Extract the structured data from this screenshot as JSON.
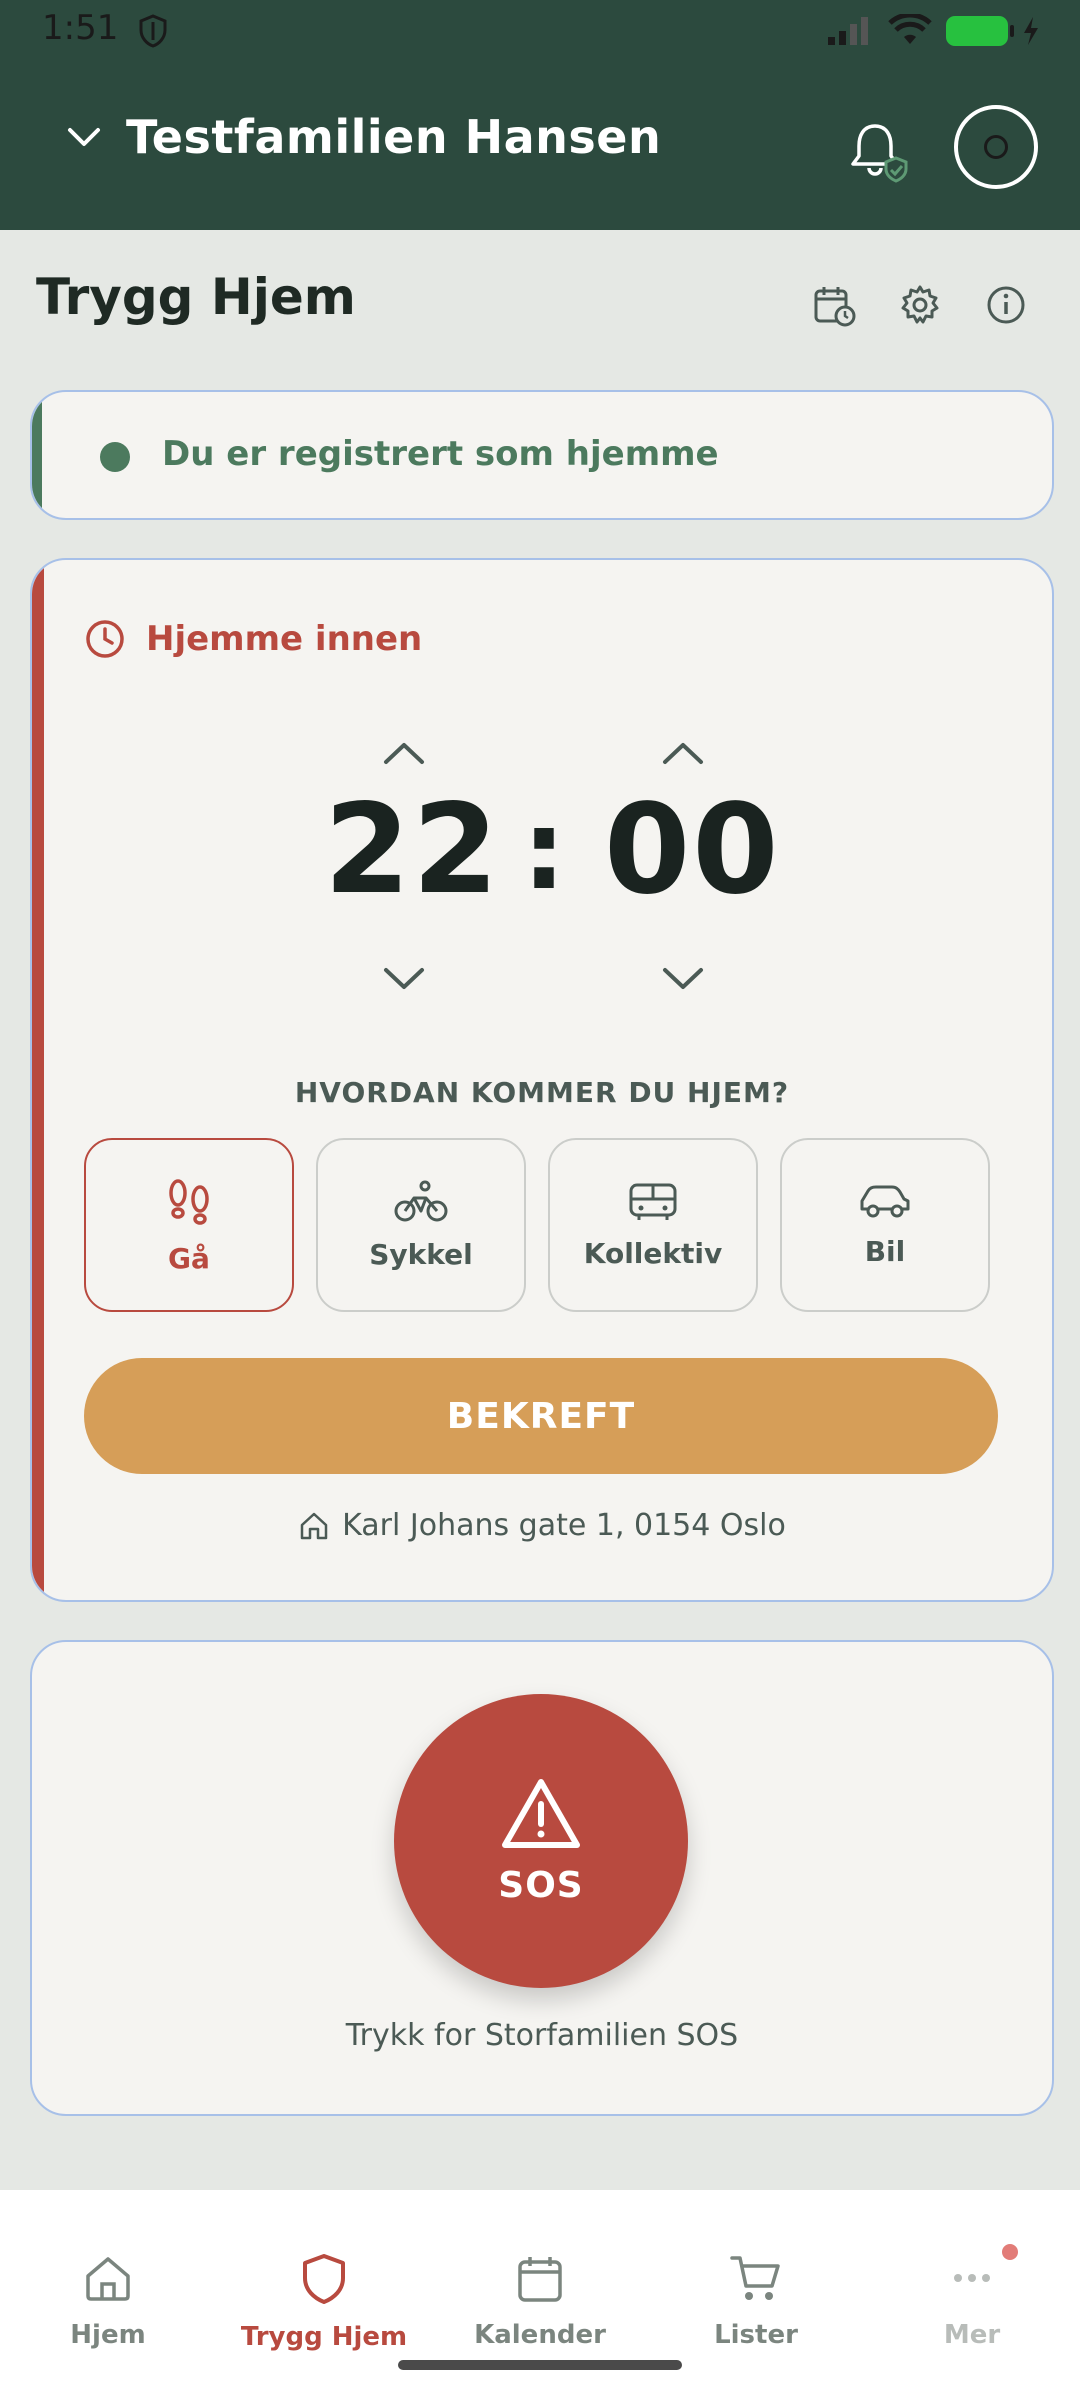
{
  "status_bar": {
    "time": "1:51"
  },
  "header": {
    "family_name": "Testfamilien Hansen",
    "avatar_initial": "O"
  },
  "page": {
    "title": "Trygg Hjem"
  },
  "status_card": {
    "text": "Du er registrert som hjemme",
    "color": "#4C7A5E"
  },
  "home_card": {
    "deadline_label": "Hjemme innen",
    "hours": "22",
    "separator": ":",
    "minutes": "00",
    "transport_question": "HVORDAN KOMMER DU HJEM?",
    "modes": [
      {
        "label": "Gå",
        "icon": "footsteps-icon",
        "selected": true
      },
      {
        "label": "Sykkel",
        "icon": "bicycle-icon",
        "selected": false
      },
      {
        "label": "Kollektiv",
        "icon": "bus-icon",
        "selected": false
      },
      {
        "label": "Bil",
        "icon": "car-icon",
        "selected": false
      }
    ],
    "confirm_label": "BEKREFT",
    "address": "Karl Johans gate 1, 0154 Oslo",
    "accent_color": "#B84A3F"
  },
  "sos_card": {
    "button_label": "SOS",
    "caption": "Trykk for Storfamilien SOS"
  },
  "bottom_nav": {
    "items": [
      {
        "label": "Hjem",
        "icon": "home-icon"
      },
      {
        "label": "Trygg Hjem",
        "icon": "shield-icon",
        "active": true
      },
      {
        "label": "Kalender",
        "icon": "calendar-icon"
      },
      {
        "label": "Lister",
        "icon": "cart-icon"
      },
      {
        "label": "Mer",
        "icon": "more-icon"
      }
    ]
  },
  "colors": {
    "header": "#2C4A3E",
    "confirm": "#D69E58",
    "sos": "#B84A3F"
  }
}
